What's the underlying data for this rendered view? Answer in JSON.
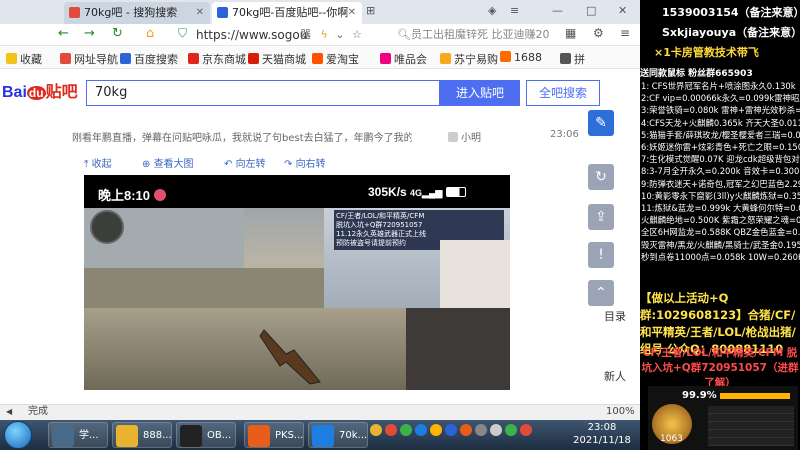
{
  "browser": {
    "tabs": [
      {
        "label": "70kg吧 - 搜狗搜索",
        "fav_color": "#e24a3b"
      },
      {
        "label": "70kg吧-百度贴吧--你啊",
        "fav_color": "#2c63d9"
      }
    ],
    "url": "https://www.sogou",
    "url_suffix": "器",
    "hint": "员工出租魔锌死 比亚迪赚20万",
    "bookmarks": [
      {
        "label": "收藏",
        "color": "#f0c419"
      },
      {
        "label": "网址导航",
        "color": "#e24a3b"
      },
      {
        "label": "百度搜索",
        "color": "#2c63d9"
      },
      {
        "label": "京东商城",
        "color": "#e1251b"
      },
      {
        "label": "天猫商城",
        "color": "#d81e06"
      },
      {
        "label": "爱淘宝",
        "color": "#ff5000"
      },
      {
        "label": "唯品会",
        "color": "#f10180"
      },
      {
        "label": "苏宁易购",
        "color": "#f7a81c"
      },
      {
        "label": "1688",
        "color": "#ff6a00"
      },
      {
        "label": "拼",
        "color": "#555555"
      }
    ],
    "search": {
      "logo": "Bai",
      "logo_du": "du",
      "logo_suffix": "贴吧",
      "query": "70kg",
      "enter_label": "进入贴吧",
      "all_label": "全吧搜索"
    },
    "post": {
      "text": "刚看年鹏直播，弹幕在问贴吧咏瓜，我就说了句best去白猛了，年鹏今了我的...",
      "author": "小明",
      "time": "23:06"
    },
    "media_tools": [
      "收起",
      "查看大图",
      "向左转",
      "向右转"
    ],
    "video": {
      "time": "晚上8:10",
      "speed": "305K/s",
      "stream_text": "CF/王者/LOL/和平精英/CFM\n脱坑入坑+Q群720951057\n11.12永久英雄武器正式上线\n预防被盗号请提前预约"
    },
    "side_text": [
      "目录",
      "新人"
    ],
    "status": "完成",
    "zoom": "100%",
    "taskbar": [
      {
        "label": "学...",
        "color": "#4a6a8a"
      },
      {
        "label": "888...",
        "color": "#e8b430"
      },
      {
        "label": "OB...",
        "color": "#222222"
      },
      {
        "label": "PKS...",
        "color": "#e85d1a"
      },
      {
        "label": "70k...",
        "color": "#1e7de0"
      }
    ],
    "clock_time": "23:08",
    "clock_date": "2021/11/18"
  },
  "overlay": {
    "line1": "1539003154（备注来意）",
    "line2": "Sxkjiayouya（备注来意）",
    "line3": "×1卡房管教技术带飞",
    "sub": "送同款鼠标   粉丝群665903",
    "list": [
      "1: CFS世界冠军名片+喷涂图永久0.130k",
      "2:CF vip=0.00066k永久=0.099k雷神昭月=0.08K",
      "3:荣誉铁骑=0.080k 雷神+雷神光效秒杀=0.288K",
      "4:CFS天龙+火麒麟0.365k 齐天大圣0.011k",
      "5:猫猫手套/薛琪玫龙/樱圣樱爱者三瑞=0.080K",
      "6:妖姬迷你雷+炫彩青色+死亡之眼=0.150K",
      "7:生化模式觉醒0.07K 迎龙cdk超级背包对讲机",
      "8:3-7月全开永久=0.200k  音效卡=0.300k",
      "9:防弹衣迷天+诺奇包,冠军之幻巴蓝色2.29k",
      "10:黄影零永下窟影(3ll)y火麒麟炼狱=0.350k",
      "11:炼狱&蓝龙=0.999k  大黄蜂何尔特=0.08k",
      "火麒麟绝地=0.500K 紫霜之怒荣耀之魂=0.8K",
      "全区6H网监龙=0.588K QBZ金色蓝金=0.108k",
      "毁灭雷神/黑龙/火麒麟/黑骑士/武圣金0.195k",
      "秒到点卷11000点=0.058k   10W=0.260K"
    ],
    "big": "【做以上活动+Q群:1029608123】合猪/CF/和平精英/王者/LOL/枪战出猪/组号  公众Q：800881110",
    "red": "CF/王者/LOL/和平精英/CFM 脱坑入坑+Q群720951057（进群了解）",
    "game_percent": "99.9%",
    "game_score": "1063"
  },
  "colors": {
    "accent": "#4e6ef2",
    "sidebar_blue": "#1e7de0",
    "overlay_yellow": "#ffe34a",
    "overlay_red": "#ff4b4b"
  }
}
